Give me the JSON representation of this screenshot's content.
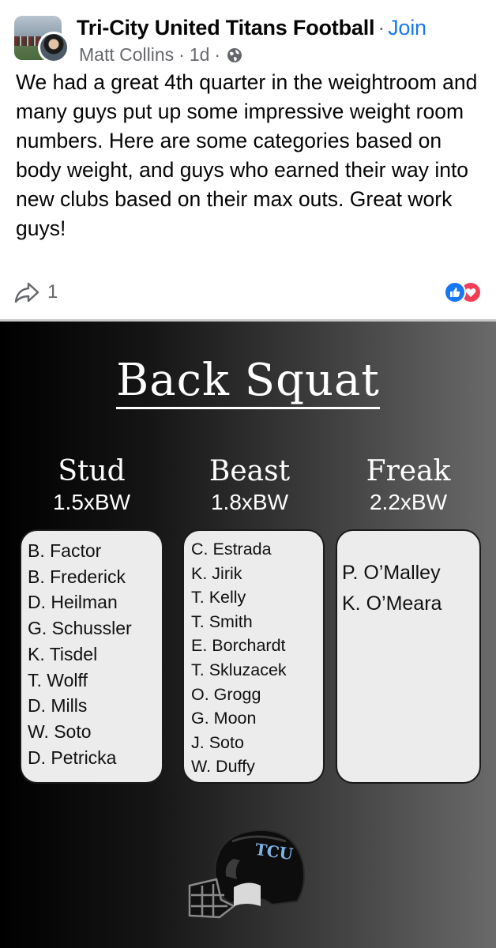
{
  "post": {
    "group_name": "Tri-City United Titans Football",
    "separator": "·",
    "join_label": "Join",
    "author": "Matt Collins",
    "time": "1d",
    "text": "We had a great 4th quarter in the weightroom and many guys put up some impressive weight room numbers. Here are some categories based on body weight, and guys who earned their way into new clubs based on their max outs. Great work guys!",
    "share_count": "1",
    "colors": {
      "link": "#1877f2",
      "secondary": "#65676b",
      "like": "#1877f2",
      "love": "#f33e58"
    },
    "icons": [
      "group-avatar",
      "user-avatar",
      "globe-icon",
      "share-icon",
      "like-icon",
      "love-icon"
    ]
  },
  "graphic": {
    "title": "Back Squat",
    "columns": [
      {
        "name": "Stud",
        "ratio": "1.5xBW",
        "athletes": [
          "B. Factor",
          "B. Frederick",
          "D. Heilman",
          "G. Schussler",
          "K. Tisdel",
          "T. Wolff",
          "D. Mills",
          "W. Soto",
          "D. Petricka"
        ]
      },
      {
        "name": "Beast",
        "ratio": "1.8xBW",
        "athletes": [
          "C. Estrada",
          "K. Jirik",
          "T. Kelly",
          "T. Smith",
          "E. Borchardt",
          "T. Skluzacek",
          "O. Grogg",
          "G. Moon",
          "J. Soto",
          "W. Duffy"
        ]
      },
      {
        "name": "Freak",
        "ratio": "2.2xBW",
        "athletes": [
          "P. O’Malley",
          "K. O’Meara"
        ]
      }
    ],
    "helmet_logo": "TCU"
  }
}
